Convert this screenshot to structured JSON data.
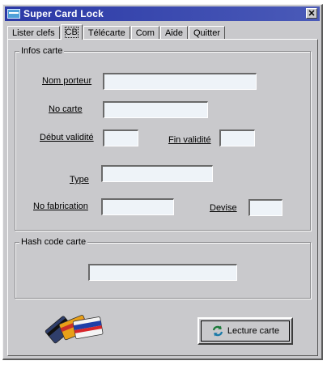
{
  "window": {
    "title": "Super Card Lock",
    "close_label": "✕"
  },
  "tabs": [
    {
      "label": "Lister clefs"
    },
    {
      "label": "CB",
      "active": true
    },
    {
      "label": "Télécarte"
    },
    {
      "label": "Com"
    },
    {
      "label": "Aide"
    },
    {
      "label": "Quitter"
    }
  ],
  "infos_carte": {
    "title": "Infos carte",
    "nom_porteur": {
      "label": "Nom porteur",
      "value": ""
    },
    "no_carte": {
      "label": "No carte",
      "value": ""
    },
    "debut_validite": {
      "label": "Début validité",
      "value": ""
    },
    "fin_validite": {
      "label": "Fin validité",
      "value": ""
    },
    "type": {
      "label": "Type",
      "value": ""
    },
    "no_fabrication": {
      "label": "No fabrication",
      "value": ""
    },
    "devise": {
      "label": "Devise",
      "value": ""
    }
  },
  "hash_code": {
    "title": "Hash code carte",
    "value": ""
  },
  "actions": {
    "lecture_label": "Lecture carte"
  },
  "icons": {
    "app": "card-icon",
    "cards": "credit-cards-icon",
    "refresh": "refresh-icon"
  }
}
